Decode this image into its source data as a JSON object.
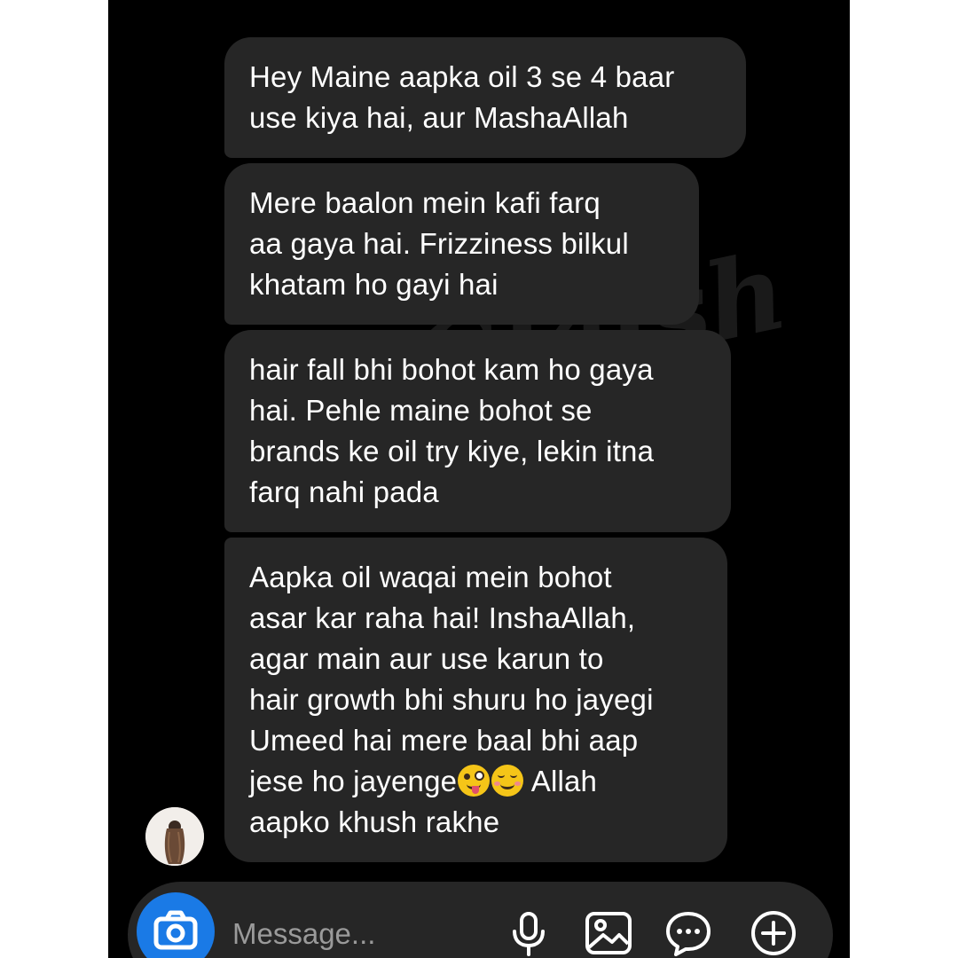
{
  "conversation": {
    "messages": [
      {
        "text": "Hey Maine aapka oil 3 se 4 baar\nuse kiya hai, aur MashaAllah"
      },
      {
        "text": "Mere baalon mein kafi farq\naa gaya hai. Frizziness bilkul\nkhatam ho gayi hai"
      },
      {
        "text": "hair fall bhi bohot kam ho gaya\nhai. Pehle maine bohot se\nbrands ke oil try kiye, lekin itna\nfarq nahi pada"
      },
      {
        "text_before_emoji": "Aapka oil waqai mein bohot\nasar kar raha hai! InshaAllah,\nagar main aur use karun to\nhair growth bhi shuru ho jayegi\nUmeed hai mere baal bhi aap\njese ho jayenge",
        "emojis": [
          "zany-face-emoji",
          "smiling-face-emoji"
        ],
        "text_after_emoji": " Allah\naapko khush rakhe"
      }
    ]
  },
  "watermark": {
    "text": "Glaish"
  },
  "composer": {
    "placeholder": "Message...",
    "icons": [
      "camera-icon",
      "microphone-icon",
      "gallery-icon",
      "sticker-icon",
      "plus-icon"
    ]
  },
  "colors": {
    "background": "#000000",
    "bubble": "#262626",
    "text": "#ffffff",
    "camera_button": "#1a7ae6",
    "placeholder": "#9a9a9a",
    "icon": "#ffffff"
  }
}
